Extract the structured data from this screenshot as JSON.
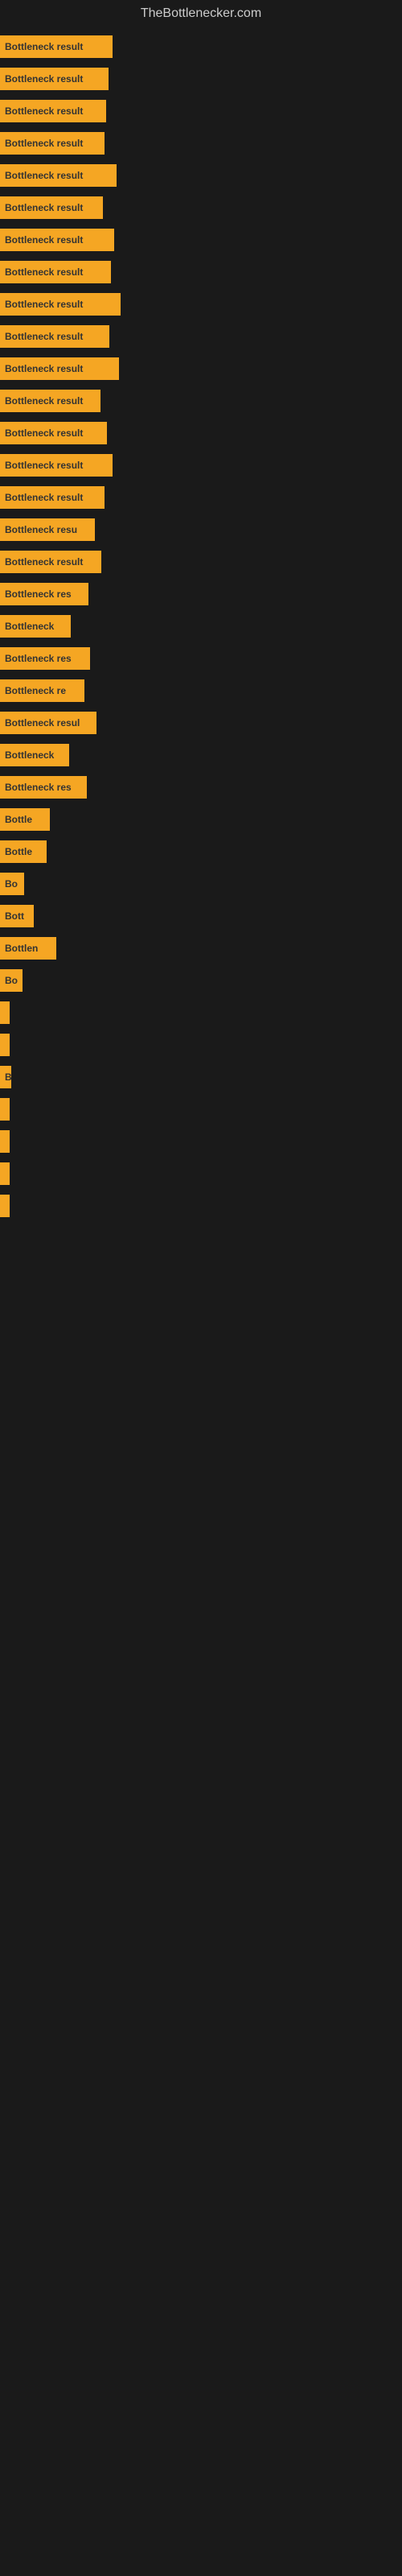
{
  "header": {
    "title": "TheBottlenecker.com"
  },
  "bars": [
    {
      "label": "Bottleneck result",
      "width": 140
    },
    {
      "label": "Bottleneck result",
      "width": 135
    },
    {
      "label": "Bottleneck result",
      "width": 132
    },
    {
      "label": "Bottleneck result",
      "width": 130
    },
    {
      "label": "Bottleneck result",
      "width": 145
    },
    {
      "label": "Bottleneck result",
      "width": 128
    },
    {
      "label": "Bottleneck result",
      "width": 142
    },
    {
      "label": "Bottleneck result",
      "width": 138
    },
    {
      "label": "Bottleneck result",
      "width": 150
    },
    {
      "label": "Bottleneck result",
      "width": 136
    },
    {
      "label": "Bottleneck result",
      "width": 148
    },
    {
      "label": "Bottleneck result",
      "width": 125
    },
    {
      "label": "Bottleneck result",
      "width": 133
    },
    {
      "label": "Bottleneck result",
      "width": 140
    },
    {
      "label": "Bottleneck result",
      "width": 130
    },
    {
      "label": "Bottleneck resu",
      "width": 118
    },
    {
      "label": "Bottleneck result",
      "width": 126
    },
    {
      "label": "Bottleneck res",
      "width": 110
    },
    {
      "label": "Bottleneck",
      "width": 88
    },
    {
      "label": "Bottleneck res",
      "width": 112
    },
    {
      "label": "Bottleneck re",
      "width": 105
    },
    {
      "label": "Bottleneck resul",
      "width": 120
    },
    {
      "label": "Bottleneck",
      "width": 86
    },
    {
      "label": "Bottleneck res",
      "width": 108
    },
    {
      "label": "Bottle",
      "width": 62
    },
    {
      "label": "Bottle",
      "width": 58
    },
    {
      "label": "Bo",
      "width": 30
    },
    {
      "label": "Bott",
      "width": 42
    },
    {
      "label": "Bottlen",
      "width": 70
    },
    {
      "label": "Bo",
      "width": 28
    },
    {
      "label": "",
      "width": 8
    },
    {
      "label": "",
      "width": 6
    },
    {
      "label": "B",
      "width": 14
    },
    {
      "label": "",
      "width": 5
    },
    {
      "label": "",
      "width": 10
    },
    {
      "label": "",
      "width": 8
    },
    {
      "label": "",
      "width": 6
    }
  ]
}
